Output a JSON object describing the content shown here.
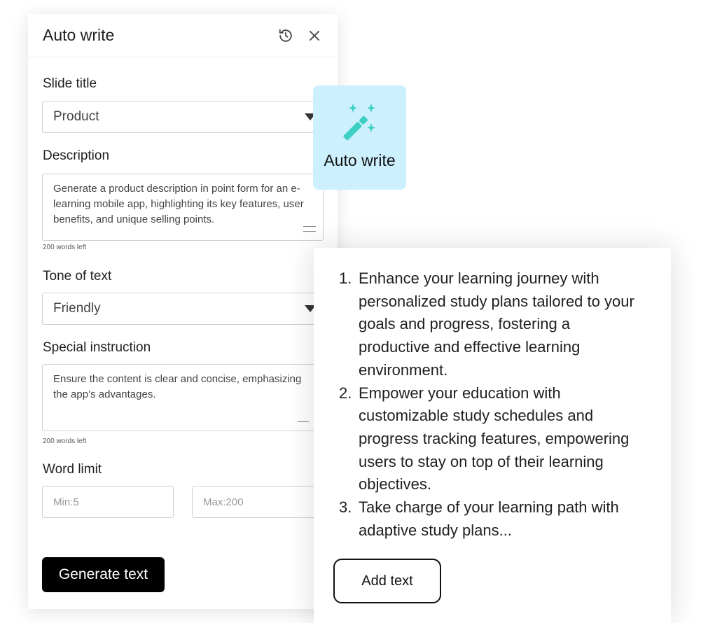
{
  "panel": {
    "title": "Auto write",
    "fields": {
      "slide_title": {
        "label": "Slide title",
        "value": "Product"
      },
      "description": {
        "label": "Description",
        "value": "Generate a product description in point form for an e-learning mobile app, highlighting its key features, user benefits, and unique selling points.",
        "words_left": "200 words left"
      },
      "tone": {
        "label": "Tone of text",
        "value": "Friendly"
      },
      "special": {
        "label": "Special instruction",
        "value": "Ensure the content is clear and concise, emphasizing the app’s advantages.",
        "words_left": "200 words left"
      },
      "word_limit": {
        "label": "Word limit",
        "min_placeholder": "Min:5",
        "max_placeholder": "Max:200"
      }
    },
    "generate_label": "Generate text"
  },
  "auto_write_card": {
    "label": "Auto write",
    "icon": "magic-wand-icon",
    "accent": "#3ecfc3",
    "background": "#ccf0fd"
  },
  "result": {
    "items": [
      {
        "num": "1.",
        "text": "Enhance your learning journey with personalized study plans tailored to your goals and progress, fostering a productive and effective learning environment."
      },
      {
        "num": "2.",
        "text": "Empower your education with customizable study schedules and progress tracking features, empowering users to stay on top of their learning objectives."
      },
      {
        "num": "3.",
        "text": "Take charge of your learning path with adaptive study plans..."
      }
    ],
    "add_label": "Add text"
  }
}
